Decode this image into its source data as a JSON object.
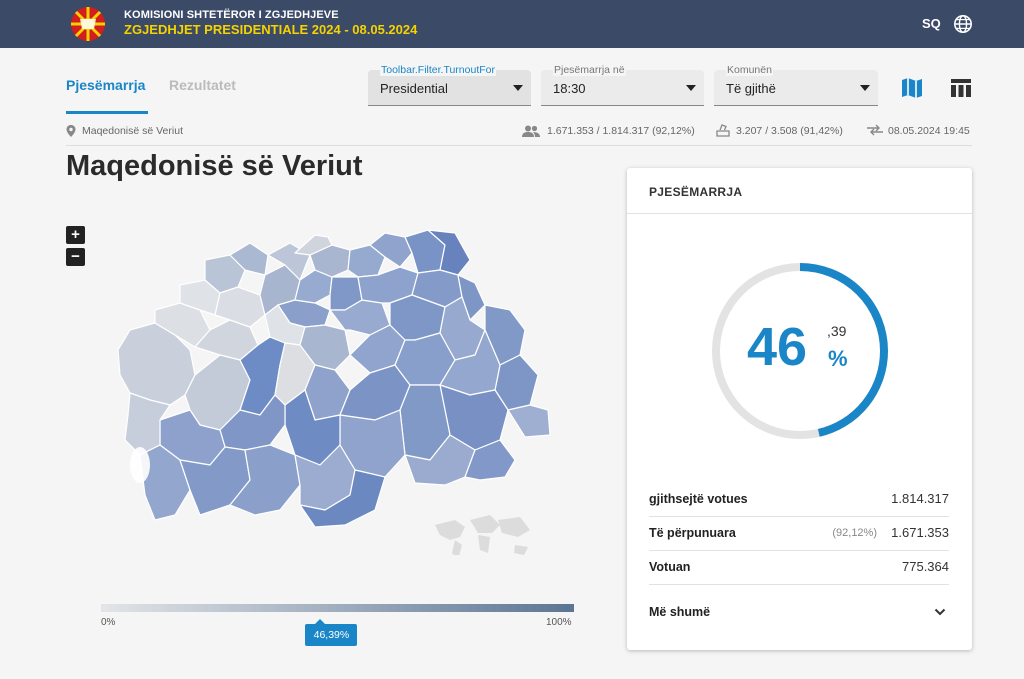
{
  "header": {
    "org": "KOMISIONI SHTETËROR I ZGJEDHJEVE",
    "election": "ZGJEDHJET PRESIDENTIALE 2024 - 08.05.2024",
    "language": "SQ"
  },
  "tabs": [
    {
      "label": "Pjesëmarrja",
      "active": true
    },
    {
      "label": "Rezultatet",
      "active": false
    }
  ],
  "filters": [
    {
      "label": "Toolbar.Filter.TurnoutFor",
      "value": "Presidential"
    },
    {
      "label": "Pjesëmarrja në",
      "value": "18:30"
    },
    {
      "label": "Komunën",
      "value": "Të gjithë"
    }
  ],
  "breadcrumb": "Maqedonisë së Veriut",
  "stats": {
    "voters": "1.671.353 / 1.814.317 (92,12%)",
    "stations": "3.207 / 3.508 (91,42%)",
    "updated": "08.05.2024 19:45"
  },
  "page_title": "Maqedonisë së Veriut",
  "map_controls": {
    "zoom_in": "+",
    "zoom_out": "−"
  },
  "legend": {
    "min": "0%",
    "max": "100%",
    "current": "46,39%",
    "current_value": 46.39
  },
  "turnout_card": {
    "title": "PJESËMARRJA",
    "percent_int": "46",
    "percent_dec": ",39",
    "percent_sign": "%",
    "percent_value": 46.39,
    "rows": [
      {
        "label": "gjithsejtë votues",
        "sub": "",
        "value": "1.814.317"
      },
      {
        "label": "Të përpunuara",
        "sub": "(92,12%)",
        "value": "1.671.353"
      },
      {
        "label": "Votuan",
        "sub": "",
        "value": "775.364"
      }
    ],
    "more": "Më shumë"
  },
  "colors": {
    "header_bg": "#3b4a67",
    "accent": "#1a86c7",
    "election_yellow": "#f5d300",
    "map_dark": "#5b7ab5",
    "map_light": "#dcdfe4"
  }
}
